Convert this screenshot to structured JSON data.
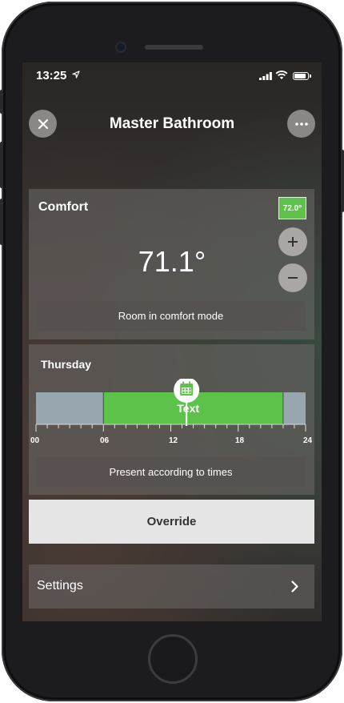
{
  "status_bar": {
    "time": "13:25"
  },
  "header": {
    "title": "Master Bathroom"
  },
  "comfort_card": {
    "title": "Comfort",
    "setpoint": "72.0°",
    "current_temp": "71.1°",
    "message": "Room in comfort mode"
  },
  "schedule_card": {
    "day": "Thursday",
    "segment_label": "Text",
    "axis_ticks": [
      "00",
      "06",
      "12",
      "18",
      "24"
    ],
    "segments": [
      {
        "start": 0,
        "end": 6,
        "state": "absent"
      },
      {
        "start": 6,
        "end": 22,
        "state": "present"
      },
      {
        "start": 22,
        "end": 24,
        "state": "absent"
      }
    ],
    "marker_hour": 13.4,
    "message": "Present according to times"
  },
  "override": {
    "label": "Override"
  },
  "settings": {
    "label": "Settings"
  },
  "colors": {
    "present": "#5cc24a",
    "absent": "#97a6af",
    "accent": "#5cc24a"
  }
}
